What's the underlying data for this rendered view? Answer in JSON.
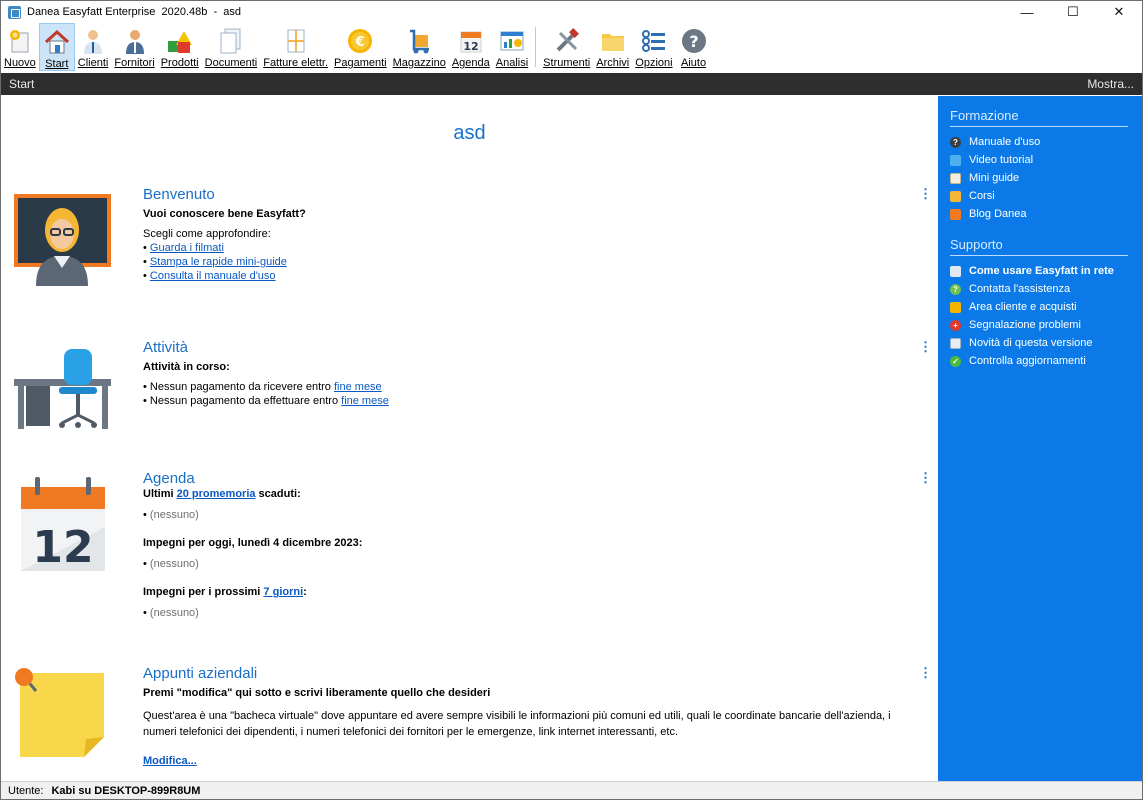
{
  "window": {
    "title": "Danea Easyfatt Enterprise  2020.48b  -  asd",
    "minimize": "—",
    "maximize": "☐",
    "close": "✕"
  },
  "toolbar": {
    "items": [
      {
        "label": "Nuovo",
        "icon": "new-icon"
      },
      {
        "label": "Start",
        "icon": "home-icon"
      },
      {
        "label": "Clienti",
        "icon": "client-person-icon"
      },
      {
        "label": "Fornitori",
        "icon": "supplier-person-icon"
      },
      {
        "label": "Prodotti",
        "icon": "products-shapes-icon"
      },
      {
        "label": "Documenti",
        "icon": "documents-icon"
      },
      {
        "label": "Fatture elettr.",
        "icon": "e-invoice-icon"
      },
      {
        "label": "Pagamenti",
        "icon": "euro-coin-icon"
      },
      {
        "label": "Magazzino",
        "icon": "warehouse-trolley-icon"
      },
      {
        "label": "Agenda",
        "icon": "calendar-icon"
      },
      {
        "label": "Analisi",
        "icon": "analysis-chart-icon"
      },
      {
        "label": "Strumenti",
        "icon": "tools-icon"
      },
      {
        "label": "Archivi",
        "icon": "folder-icon"
      },
      {
        "label": "Opzioni",
        "icon": "options-icon"
      },
      {
        "label": "Aiuto",
        "icon": "help-icon"
      }
    ]
  },
  "section_bar": {
    "title": "Start",
    "more": "Mostra..."
  },
  "main": {
    "company_name": "asd",
    "benvenuto": {
      "title": "Benvenuto",
      "subtitle": "Vuoi conoscere bene Easyfatt?",
      "intro": "Scegli come approfondire:",
      "links": [
        "Guarda i filmati",
        "Stampa le rapide mini-guide",
        "Consulta il manuale d'uso"
      ]
    },
    "attivita": {
      "title": "Attività",
      "subtitle": "Attività in corso:",
      "line1_text": "Nessun pagamento da ricevere entro ",
      "line1_link": "fine mese",
      "line2_text": "Nessun pagamento da effettuare entro ",
      "line2_link": "fine mese"
    },
    "agenda": {
      "title": "Agenda",
      "calendar_day": "12",
      "expired_prefix": "Ultimi ",
      "expired_link": "20 promemoria",
      "expired_suffix": " scaduti:",
      "none1": "(nessuno)",
      "today": "Impegni per oggi, lunedì 4 dicembre 2023:",
      "none2": "(nessuno)",
      "next_prefix": "Impegni per i prossimi ",
      "next_link": "7 giorni",
      "next_suffix": ":",
      "none3": "(nessuno)"
    },
    "appunti": {
      "title": "Appunti aziendali",
      "subtitle": "Premi \"modifica\" qui sotto e scrivi liberamente quello che desideri",
      "body": "Quest'area è una \"bacheca virtuale\" dove appuntare ed avere sempre visibili le informazioni più comuni ed utili, quali le coordinate bancarie dell'azienda, i numeri telefonici dei dipendenti, i numeri telefonici dei fornitori per le emergenze, link internet interessanti, etc.",
      "edit_link": "Modifica..."
    }
  },
  "sidebar": {
    "formazione": {
      "heading": "Formazione",
      "items": [
        {
          "label": "Manuale d'uso",
          "icon": "manual-help-icon"
        },
        {
          "label": "Video tutorial",
          "icon": "video-icon"
        },
        {
          "label": "Mini guide",
          "icon": "book-icon"
        },
        {
          "label": "Corsi",
          "icon": "courses-person-icon"
        },
        {
          "label": "Blog Danea",
          "icon": "rss-icon"
        }
      ]
    },
    "supporto": {
      "heading": "Supporto",
      "items": [
        {
          "label": "Come usare Easyfatt in rete",
          "icon": "network-icon"
        },
        {
          "label": "Contatta l'assistenza",
          "icon": "support-help-icon"
        },
        {
          "label": "Area cliente e acquisti",
          "icon": "cart-icon"
        },
        {
          "label": "Segnalazione problemi",
          "icon": "red-cross-icon"
        },
        {
          "label": "Novità di questa versione",
          "icon": "news-icon"
        },
        {
          "label": "Controlla aggiornamenti",
          "icon": "check-icon"
        }
      ]
    }
  },
  "status": {
    "label": "Utente:",
    "value": "Kabi su DESKTOP-899R8UM"
  },
  "colors": {
    "accent": "#1a6fc7",
    "sidebar": "#0b7ae8",
    "section_bar": "#2d2d2d"
  }
}
